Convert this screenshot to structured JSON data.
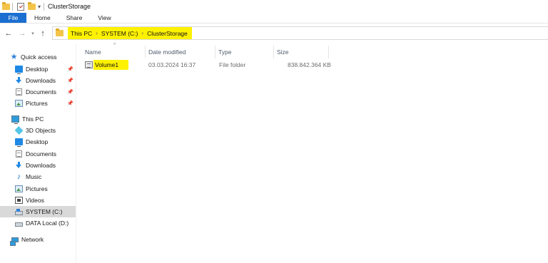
{
  "window": {
    "title": "ClusterStorage"
  },
  "ribbon": {
    "tabs": [
      "File",
      "Home",
      "Share",
      "View"
    ]
  },
  "address": {
    "breadcrumbs": [
      "This PC",
      "SYSTEM (C:)",
      "ClusterStorage"
    ],
    "separator": "›",
    "highlight_color": "#fff200"
  },
  "navigation": {
    "quick_access": {
      "label": "Quick access",
      "items": [
        {
          "label": "Desktop",
          "icon": "desktop-icon",
          "pinned": true
        },
        {
          "label": "Downloads",
          "icon": "downloads-icon",
          "pinned": true
        },
        {
          "label": "Documents",
          "icon": "documents-icon",
          "pinned": true
        },
        {
          "label": "Pictures",
          "icon": "pictures-icon",
          "pinned": true
        }
      ]
    },
    "this_pc": {
      "label": "This PC",
      "items": [
        {
          "label": "3D Objects",
          "icon": "3d-objects-icon"
        },
        {
          "label": "Desktop",
          "icon": "desktop-icon"
        },
        {
          "label": "Documents",
          "icon": "documents-icon"
        },
        {
          "label": "Downloads",
          "icon": "downloads-icon"
        },
        {
          "label": "Music",
          "icon": "music-icon"
        },
        {
          "label": "Pictures",
          "icon": "pictures-icon"
        },
        {
          "label": "Videos",
          "icon": "videos-icon"
        },
        {
          "label": "SYSTEM (C:)",
          "icon": "system-drive-icon",
          "selected": true
        },
        {
          "label": "DATA Local (D:)",
          "icon": "data-drive-icon"
        }
      ]
    },
    "network": {
      "label": "Network"
    }
  },
  "columns": {
    "name": "Name",
    "date_modified": "Date modified",
    "type": "Type",
    "size": "Size"
  },
  "files": [
    {
      "name": "Volume1",
      "date_modified": "03.03.2024 16:37",
      "type": "File folder",
      "size": "838.842.364 KB"
    }
  ],
  "colors": {
    "file_tab": "#1a6fd1",
    "highlight": "#fff200",
    "selected_nav": "#d9d9d9"
  }
}
